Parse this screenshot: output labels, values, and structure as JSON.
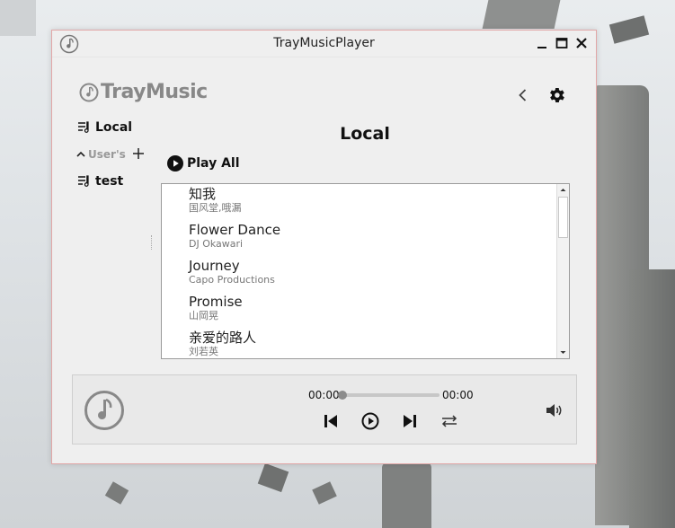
{
  "window": {
    "title": "TrayMusicPlayer"
  },
  "brand": {
    "logo_text": "TrayMusic"
  },
  "sidebar": {
    "local_label": "Local",
    "section_label": "User's",
    "playlists": [
      {
        "label": "test"
      }
    ]
  },
  "main": {
    "page_title": "Local",
    "play_all_label": "Play All",
    "songs": [
      {
        "name": "知我",
        "artist": "国风堂,哦漏"
      },
      {
        "name": "Flower Dance",
        "artist": "DJ Okawari"
      },
      {
        "name": "Journey",
        "artist": "Capo Productions"
      },
      {
        "name": "Promise",
        "artist": "山岡晃"
      },
      {
        "name": "亲爱的路人",
        "artist": "刘若英"
      }
    ]
  },
  "player": {
    "current_time": "00:00",
    "total_time": "00:00",
    "progress": 0
  },
  "icons": {
    "app": "music-note-icon",
    "back": "chevron-left-icon",
    "settings": "gear-icon",
    "playlist": "playlist-icon",
    "collapse": "chevron-up-icon",
    "add": "plus-icon",
    "play_all": "play-circle-icon",
    "prev": "skip-previous-icon",
    "play": "play-icon",
    "next": "skip-next-icon",
    "mode": "repeat-icon",
    "volume": "volume-icon"
  },
  "colors": {
    "window_border": "#e2a7a7",
    "text_primary": "#111111",
    "text_secondary": "#777777",
    "logo": "#888888"
  }
}
